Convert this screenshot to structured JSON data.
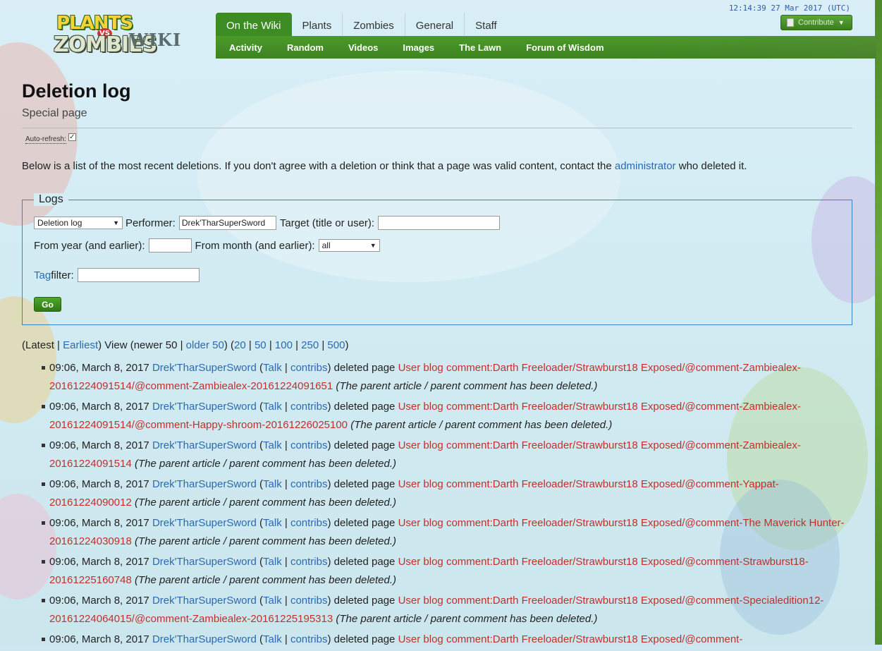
{
  "header": {
    "logo_line1": "PLANTS",
    "logo_vs": "VS",
    "logo_line2": "ZOMBIES",
    "logo_wiki": "WIKI",
    "clock": "12:14:39 27 Mar 2017 (UTC)",
    "contribute_label": "Contribute",
    "tabs": [
      {
        "label": "On the Wiki"
      },
      {
        "label": "Plants"
      },
      {
        "label": "Zombies"
      },
      {
        "label": "General"
      },
      {
        "label": "Staff"
      }
    ],
    "subnav": [
      {
        "label": "Activity"
      },
      {
        "label": "Random"
      },
      {
        "label": "Videos"
      },
      {
        "label": "Images"
      },
      {
        "label": "The Lawn"
      },
      {
        "label": "Forum of Wisdom"
      }
    ]
  },
  "page": {
    "title": "Deletion log",
    "subtitle": "Special page",
    "autorefresh_label": "Auto-refresh:",
    "intro_before": "Below is a list of the most recent deletions. If you don't agree with a deletion or think that a page was valid content, contact the ",
    "intro_link": "administrator",
    "intro_after": " who deleted it."
  },
  "form": {
    "legend": "Logs",
    "log_type": "Deletion log",
    "performer_label": "Performer:",
    "performer_value": "Drek'TharSuperSword",
    "target_label": "Target (title or user):",
    "target_value": "",
    "year_label": "From year (and earlier):",
    "year_value": "",
    "month_label": "From month (and earlier):",
    "month_value": "all",
    "tag_link": "Tag",
    "tag_label": " filter:",
    "tag_value": "",
    "go_label": "Go"
  },
  "pager": {
    "open": "(",
    "latest": "Latest",
    "sep1": " | ",
    "earliest": "Earliest",
    "view": ") View (newer 50 | ",
    "older": "older 50",
    "mid": ") (",
    "n20": "20",
    "n50": "50",
    "n100": "100",
    "n250": "250",
    "n500": "500",
    "close": ")"
  },
  "entries": [
    {
      "time": "09:06, March 8, 2017",
      "user": "Drek'TharSuperSword",
      "talk": "Talk",
      "contribs": "contribs",
      "action": " deleted page ",
      "page": "User blog comment:Darth Freeloader/Strawburst18 Exposed/@comment-Zambiealex-20161224091514/@comment-Zambiealex-20161224091651",
      "reason": "(The parent article / parent comment has been deleted.)"
    },
    {
      "time": "09:06, March 8, 2017",
      "user": "Drek'TharSuperSword",
      "talk": "Talk",
      "contribs": "contribs",
      "action": " deleted page ",
      "page": "User blog comment:Darth Freeloader/Strawburst18 Exposed/@comment-Zambiealex-20161224091514/@comment-Happy-shroom-20161226025100",
      "reason": "(The parent article / parent comment has been deleted.)"
    },
    {
      "time": "09:06, March 8, 2017",
      "user": "Drek'TharSuperSword",
      "talk": "Talk",
      "contribs": "contribs",
      "action": " deleted page ",
      "page": "User blog comment:Darth Freeloader/Strawburst18 Exposed/@comment-Zambiealex-20161224091514",
      "reason": "(The parent article / parent comment has been deleted.)"
    },
    {
      "time": "09:06, March 8, 2017",
      "user": "Drek'TharSuperSword",
      "talk": "Talk",
      "contribs": "contribs",
      "action": " deleted page ",
      "page": "User blog comment:Darth Freeloader/Strawburst18 Exposed/@comment-Yappat-20161224090012",
      "reason": "(The parent article / parent comment has been deleted.)"
    },
    {
      "time": "09:06, March 8, 2017",
      "user": "Drek'TharSuperSword",
      "talk": "Talk",
      "contribs": "contribs",
      "action": " deleted page ",
      "page": "User blog comment:Darth Freeloader/Strawburst18 Exposed/@comment-The Maverick Hunter-20161224030918",
      "reason": "(The parent article / parent comment has been deleted.)"
    },
    {
      "time": "09:06, March 8, 2017",
      "user": "Drek'TharSuperSword",
      "talk": "Talk",
      "contribs": "contribs",
      "action": " deleted page ",
      "page": "User blog comment:Darth Freeloader/Strawburst18 Exposed/@comment-Strawburst18-20161225160748",
      "reason": "(The parent article / parent comment has been deleted.)"
    },
    {
      "time": "09:06, March 8, 2017",
      "user": "Drek'TharSuperSword",
      "talk": "Talk",
      "contribs": "contribs",
      "action": " deleted page ",
      "page": "User blog comment:Darth Freeloader/Strawburst18 Exposed/@comment-Specialedition12-20161224064015/@comment-Zambiealex-20161225195313",
      "reason": "(The parent article / parent comment has been deleted.)"
    },
    {
      "time": "09:06, March 8, 2017",
      "user": "Drek'TharSuperSword",
      "talk": "Talk",
      "contribs": "contribs",
      "action": " deleted page ",
      "page": "User blog comment:Darth Freeloader/Strawburst18 Exposed/@comment-",
      "reason": ""
    }
  ]
}
